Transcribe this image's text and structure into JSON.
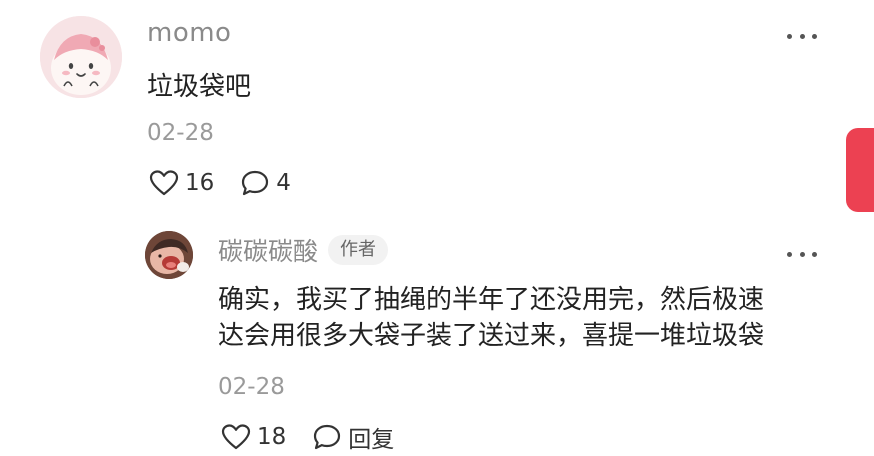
{
  "comment": {
    "username": "momo",
    "content": "垃圾袋吧",
    "date": "02-28",
    "likes": "16",
    "replies": "4"
  },
  "reply": {
    "username": "碳碳碳酸",
    "badge": "作者",
    "content_lines": [
      "确实，我买了抽绳的半年了还没用完，然后极速",
      "达会用很多大袋子装了送过来，喜提一堆垃圾袋"
    ],
    "date": "02-28",
    "likes": "18",
    "reply_label": "回复"
  },
  "icons": {
    "like": "heart-outline-icon",
    "comment": "speech-bubble-icon",
    "more": "more-dots-icon"
  },
  "colors": {
    "side_tab": "#ec4152",
    "username": "#8a8a8a",
    "date": "#9a9a9a"
  }
}
